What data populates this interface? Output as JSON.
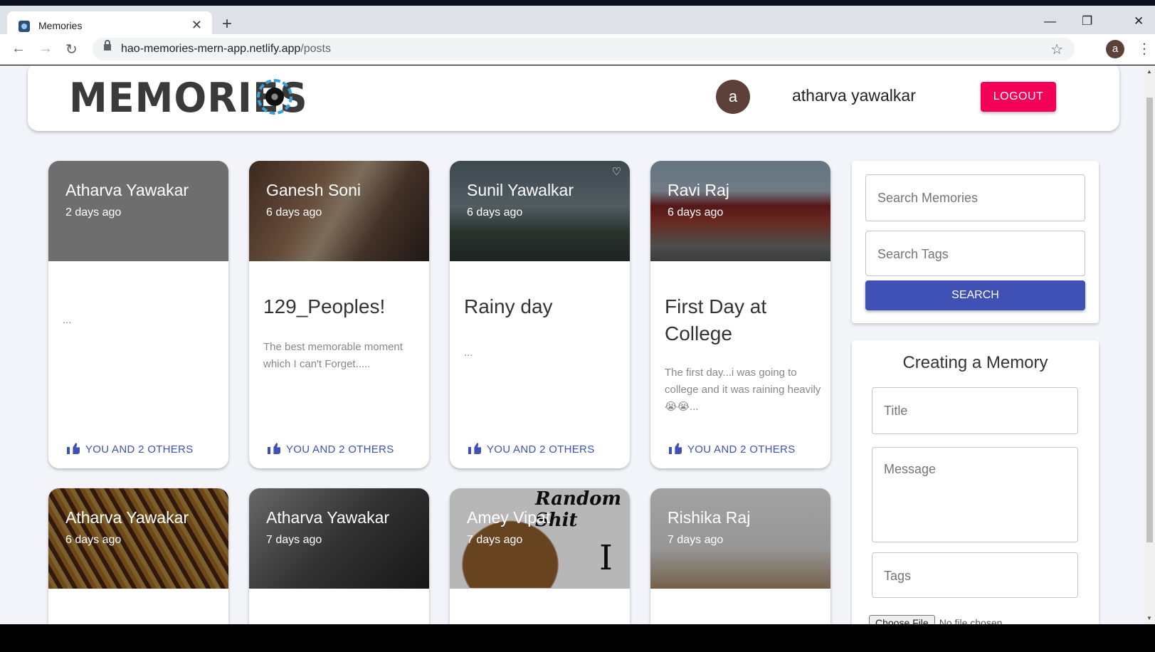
{
  "browser": {
    "tab_title": "Memories",
    "tab_close": "✕",
    "new_tab": "+",
    "url_host": "hao-memories-mern-app.netlify.app",
    "url_path": "/posts",
    "profile_initial": "a",
    "window_controls": [
      "—",
      "❐",
      "✕"
    ]
  },
  "app": {
    "logo_text": "MEMORIES",
    "avatar_initial": "a",
    "username": "atharva yawalkar",
    "logout_label": "LOGOUT"
  },
  "posts": [
    {
      "author": "Atharva Yawakar",
      "ago": "2 days ago",
      "title": "",
      "message": "...",
      "likes": "YOU AND 2 OTHERS",
      "image": "placeholder"
    },
    {
      "author": "Ganesh Soni",
      "ago": "6 days ago",
      "title": "129_Peoples!",
      "message": "The best memorable moment which I can't Forget.....",
      "likes": "YOU AND 2 OTHERS",
      "image": "group-photo"
    },
    {
      "author": "Sunil Yawalkar",
      "ago": "6 days ago",
      "title": "Rainy day",
      "message": "...",
      "likes": "YOU AND 2 OTHERS",
      "image": "rainy-road"
    },
    {
      "author": "Ravi Raj",
      "ago": "6 days ago",
      "title": "First Day at College",
      "message": "The first day...i was going to college and it was raining heavily 😭😭...",
      "likes": "YOU AND 2 OTHERS",
      "image": "college-building"
    },
    {
      "author": "Atharva Yawakar",
      "ago": "6 days ago",
      "image": "fries"
    },
    {
      "author": "Atharva Yawakar",
      "ago": "7 days ago",
      "image": "couple"
    },
    {
      "author": "Amey Vipat",
      "ago": "7 days ago",
      "image": "poop-emoji",
      "image_text": "Random Shit",
      "image_letter": "I"
    },
    {
      "author": "Rishika Raj",
      "ago": "7 days ago",
      "image": "dog"
    }
  ],
  "search": {
    "memories_placeholder": "Search Memories",
    "tags_placeholder": "Search Tags",
    "button_label": "SEARCH"
  },
  "form": {
    "heading": "Creating a Memory",
    "title_placeholder": "Title",
    "message_placeholder": "Message",
    "tags_placeholder": "Tags",
    "choose_file_label": "Choose File",
    "no_file_label": "No file chosen"
  },
  "colors": {
    "primary": "#3f51b5",
    "secondary": "#f50057",
    "avatar": "#5d4037"
  }
}
